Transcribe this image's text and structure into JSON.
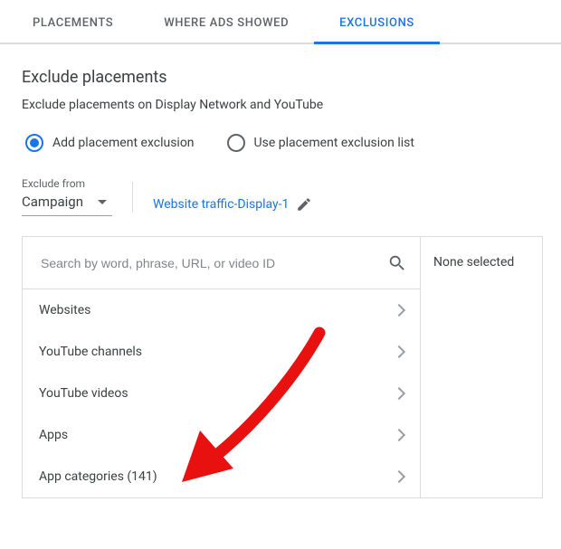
{
  "tabs": {
    "placements": "PLACEMENTS",
    "where_showed": "WHERE ADS SHOWED",
    "exclusions": "EXCLUSIONS"
  },
  "heading": "Exclude placements",
  "subtext": "Exclude placements on Display Network and YouTube",
  "radio": {
    "add": "Add placement exclusion",
    "uselist": "Use placement exclusion list"
  },
  "exclude_from": {
    "label": "Exclude from",
    "value": "Campaign"
  },
  "campaign_name": "Website traffic-Display-1",
  "search": {
    "placeholder": "Search by word, phrase, URL, or video ID"
  },
  "categories": [
    "Websites",
    "YouTube channels",
    "YouTube videos",
    "Apps",
    "App categories (141)"
  ],
  "none_selected": "None selected"
}
